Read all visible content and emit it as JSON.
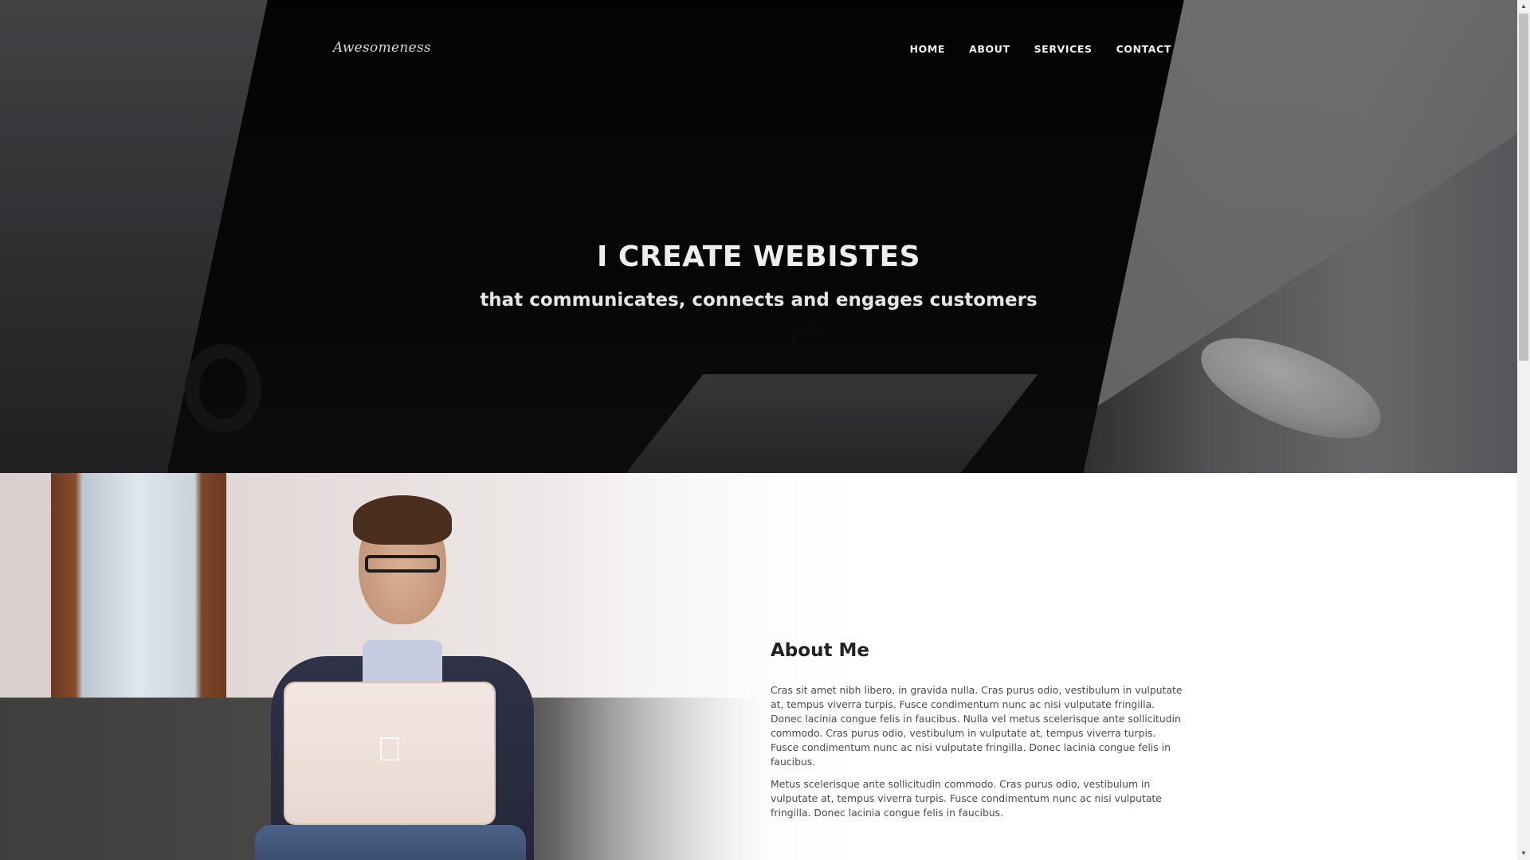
{
  "navbar": {
    "brand": "Awesomeness",
    "links": [
      "HOME",
      "ABOUT",
      "SERVICES",
      "CONTACT"
    ]
  },
  "hero": {
    "title": "I CREATE WEBISTES",
    "subtitle": "that communicates, connects and engages customers"
  },
  "about": {
    "heading": "About Me",
    "paragraphs": [
      "Cras sit amet nibh libero, in gravida nulla. Cras purus odio, vestibulum in vulputate at, tempus viverra turpis. Fusce condimentum nunc ac nisi vulputate fringilla. Donec lacinia congue felis in faucibus. Nulla vel metus scelerisque ante sollicitudin commodo. Cras purus odio, vestibulum in vulputate at, tempus viverra turpis. Fusce condimentum nunc ac nisi vulputate fringilla. Donec lacinia congue felis in faucibus.",
      "Metus scelerisque ante sollicitudin commodo. Cras purus odio, vestibulum in vulputate at, tempus viverra turpis. Fusce condimentum nunc ac nisi vulputate fringilla. Donec lacinia congue felis in faucibus."
    ]
  },
  "icons": {
    "hero_apple": "apple-logo-icon",
    "laptop_apple": "apple-logo-icon",
    "scroll_up": "triangle-up-icon",
    "scroll_down": "triangle-down-icon"
  },
  "scrollbar": {
    "position_fraction": 0
  }
}
